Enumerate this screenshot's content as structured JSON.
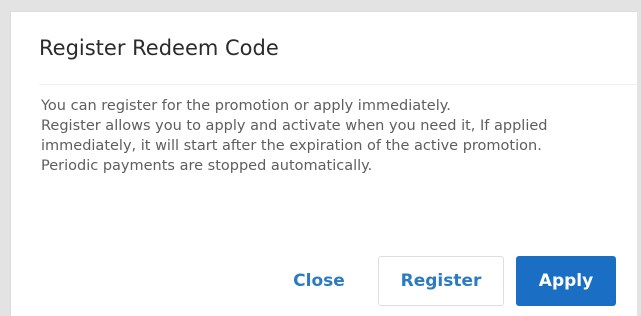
{
  "dialog": {
    "title": "Register Redeem Code",
    "body": [
      "You can register for the promotion or apply immediately.",
      "Register allows you to apply and activate when you need it, If applied immediately, it will start after the expiration of the active promotion.",
      "Periodic payments are stopped automatically."
    ],
    "buttons": {
      "close": "Close",
      "register": "Register",
      "apply": "Apply"
    }
  },
  "colors": {
    "accent": "#1a6fc4",
    "link": "#2c7bc0"
  }
}
